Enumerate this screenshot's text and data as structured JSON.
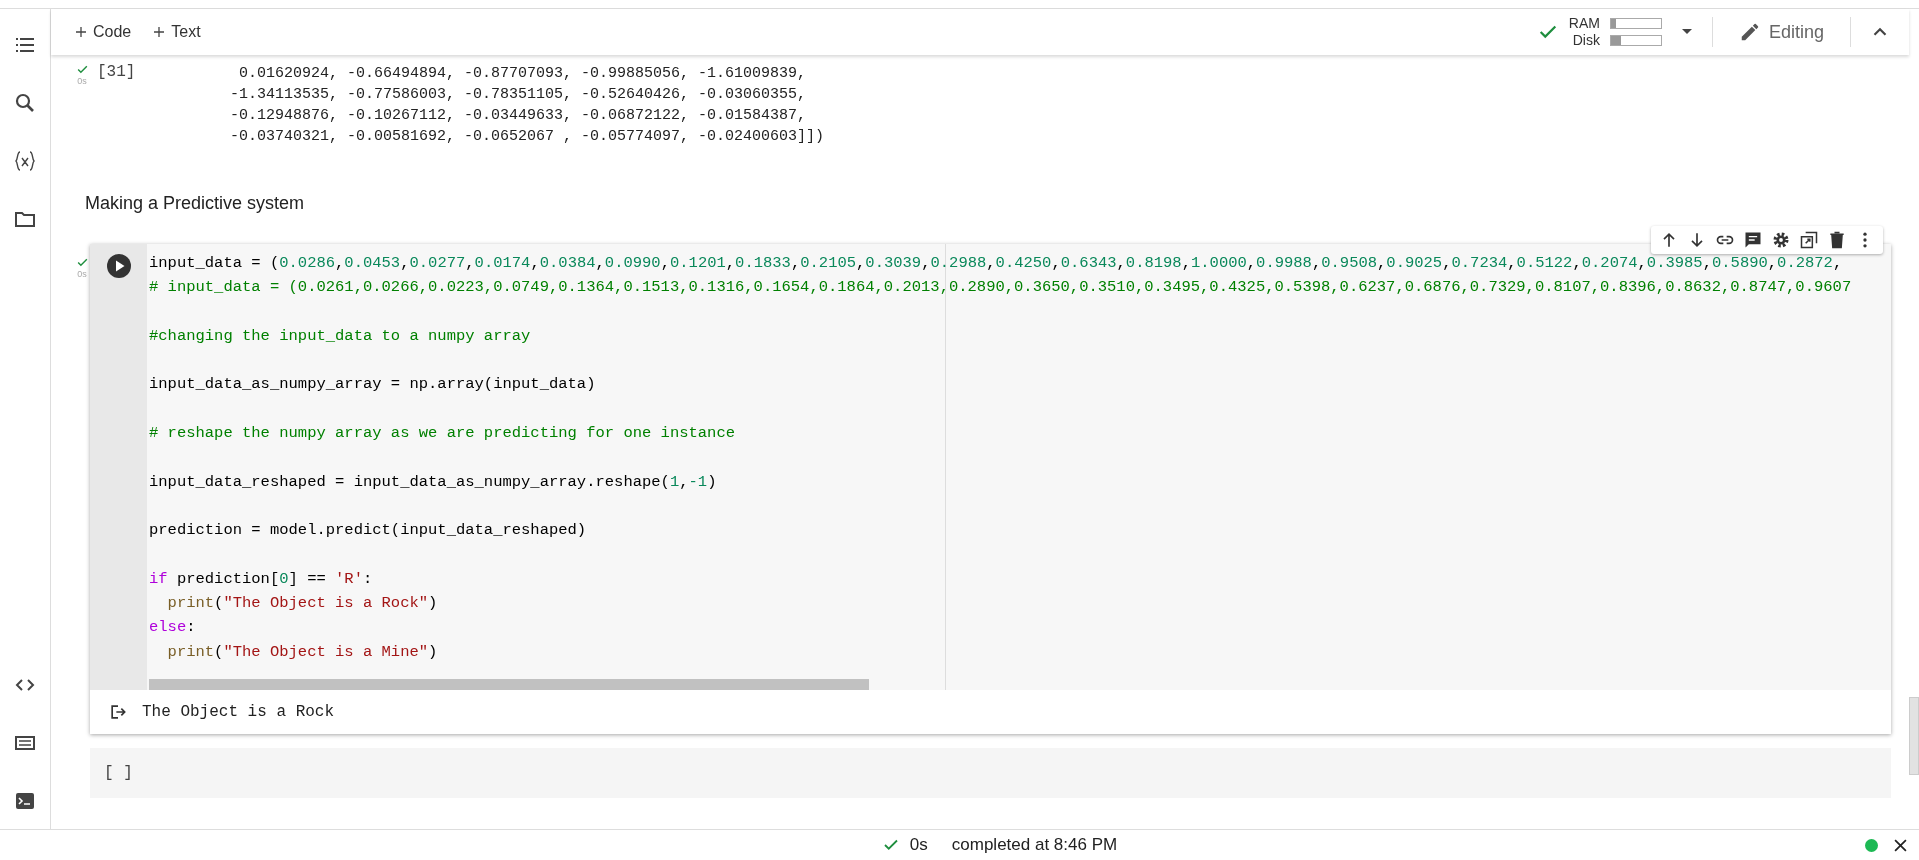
{
  "toolbar": {
    "add_buttons": [
      {
        "label": "Code"
      },
      {
        "label": "Text"
      }
    ],
    "resources": [
      {
        "label": "RAM",
        "level": 0.1
      },
      {
        "label": "Disk",
        "level": 0.2
      }
    ],
    "mode": "Editing"
  },
  "previous_cell": {
    "execution_count": "[31]",
    "time": "0s",
    "output_lines": [
      " 0.01620924, -0.66494894, -0.87707093, -0.99885056, -1.61009839,",
      "-1.34113535, -0.77586003, -0.78351105, -0.52640426, -0.03060355,",
      "-0.12948876, -0.10267112, -0.03449633, -0.06872122, -0.01584387,",
      "-0.03740321, -0.00581692, -0.0652067 , -0.05774097, -0.02400603]])"
    ]
  },
  "text_cell": "Making a Predictive system",
  "code_cell": {
    "time": "0s",
    "lines": [
      {
        "blank_before": false,
        "indent": false,
        "tokens": [
          {
            "kind": "plain",
            "text": "input_data = ("
          },
          {
            "kind": "nums",
            "text": "0.0286,0.0453,0.0277,0.0174,0.0384,0.0990,0.1201,0.1833,0.2105,0.3039,0.2988,0.4250,0.6343,0.8198,1.0000,0.9988,0.9508,0.9025,0.7234,0.5122,0.2074,0.3985,0.5890,0.2872,"
          }
        ]
      },
      {
        "blank_before": false,
        "indent": false,
        "tokens": [
          {
            "kind": "comment",
            "text": "# input_data = (0.0261,0.0266,0.0223,0.0749,0.1364,0.1513,0.1316,0.1654,0.1864,0.2013,0.2890,0.3650,0.3510,0.3495,0.4325,0.5398,0.6237,0.6876,0.7329,0.8107,0.8396,0.8632,0.8747,0.9607"
          }
        ]
      },
      {
        "blank_before": true,
        "indent": false,
        "tokens": [
          {
            "kind": "comment",
            "text": "#changing the input_data to a numpy array"
          }
        ]
      },
      {
        "blank_before": true,
        "indent": false,
        "tokens": [
          {
            "kind": "plain",
            "text": "input_data_as_numpy_array = np.array(input_data)"
          }
        ]
      },
      {
        "blank_before": true,
        "indent": false,
        "tokens": [
          {
            "kind": "comment",
            "text": "# reshape the numpy array as we are predicting for one instance"
          }
        ]
      },
      {
        "blank_before": true,
        "indent": false,
        "tokens": [
          {
            "kind": "plain",
            "text": "input_data_reshaped = input_data_as_numpy_array.reshape("
          },
          {
            "kind": "num",
            "text": "1"
          },
          {
            "kind": "plain",
            "text": ","
          },
          {
            "kind": "num",
            "text": "-1"
          },
          {
            "kind": "plain",
            "text": ")"
          }
        ]
      },
      {
        "blank_before": true,
        "indent": false,
        "tokens": [
          {
            "kind": "plain",
            "text": "prediction = model.predict(input_data_reshaped)"
          }
        ]
      },
      {
        "blank_before": true,
        "indent": false,
        "tokens": [
          {
            "kind": "keyword",
            "text": "if"
          },
          {
            "kind": "plain",
            "text": " prediction["
          },
          {
            "kind": "num",
            "text": "0"
          },
          {
            "kind": "plain",
            "text": "] == "
          },
          {
            "kind": "str",
            "text": "'R'"
          },
          {
            "kind": "plain",
            "text": ":"
          }
        ]
      },
      {
        "blank_before": false,
        "indent": true,
        "tokens": [
          {
            "kind": "builtin",
            "text": "print"
          },
          {
            "kind": "plain",
            "text": "("
          },
          {
            "kind": "str",
            "text": "\"The Object is a Rock\""
          },
          {
            "kind": "plain",
            "text": ")"
          }
        ]
      },
      {
        "blank_before": false,
        "indent": false,
        "tokens": [
          {
            "kind": "keyword",
            "text": "else"
          },
          {
            "kind": "plain",
            "text": ":"
          }
        ]
      },
      {
        "blank_before": false,
        "indent": true,
        "tokens": [
          {
            "kind": "builtin",
            "text": "print"
          },
          {
            "kind": "plain",
            "text": "("
          },
          {
            "kind": "str",
            "text": "\"The Object is a Mine\""
          },
          {
            "kind": "plain",
            "text": ")"
          }
        ]
      }
    ],
    "output": "The Object is a Rock"
  },
  "empty_cell": {
    "label": "[ ]"
  },
  "status_bar": {
    "time": "0s",
    "message": "completed at 8:46 PM"
  }
}
